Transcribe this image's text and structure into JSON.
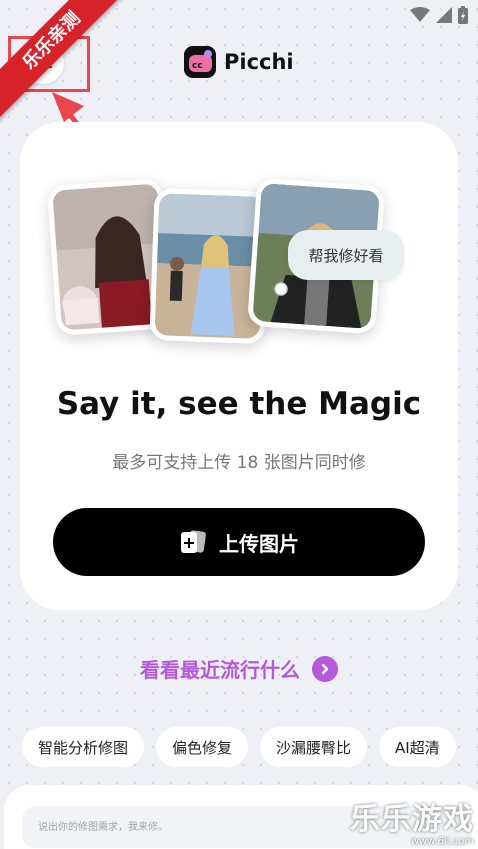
{
  "watermark": {
    "corner_label": "乐乐亲测",
    "brand": "乐乐游戏",
    "url": "www.6ll.com"
  },
  "header": {
    "app_name": "Picchi",
    "menu_icon": "hamburger-menu-icon"
  },
  "hero": {
    "bubble_text": "帮我修好看",
    "title": "Say it, see the Magic",
    "subtitle": "最多可支持上传 18 张图片同时修",
    "upload_label": "上传图片"
  },
  "trending": {
    "label": "看看最近流行什么"
  },
  "chips": [
    {
      "label": "智能分析修图"
    },
    {
      "label": "偏色修复"
    },
    {
      "label": "沙漏腰臀比"
    },
    {
      "label": "AI超清"
    }
  ],
  "input": {
    "placeholder": "说出你的修图需求，我来修。"
  },
  "colors": {
    "accent": "#b45ad8",
    "button": "#000000",
    "highlight": "#e8474e"
  }
}
